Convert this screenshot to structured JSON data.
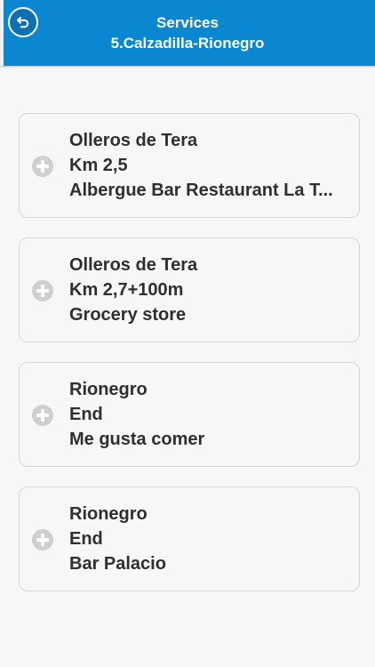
{
  "header": {
    "title": "Services",
    "subtitle": "5.Calzadilla-Rionegro",
    "background_color": "#0a87d1",
    "back_icon": "back-arrow-icon"
  },
  "services": [
    {
      "place": "Olleros de Tera",
      "location": "Km 2,5",
      "name": "Albergue Bar Restaurant La T..."
    },
    {
      "place": "Olleros de Tera",
      "location": "Km 2,7+100m",
      "name": "Grocery store"
    },
    {
      "place": "Rionegro",
      "location": "End",
      "name": "Me gusta comer"
    },
    {
      "place": "Rionegro",
      "location": "End",
      "name": "Bar Palacio"
    }
  ],
  "item_icon": "plus-circle-icon"
}
